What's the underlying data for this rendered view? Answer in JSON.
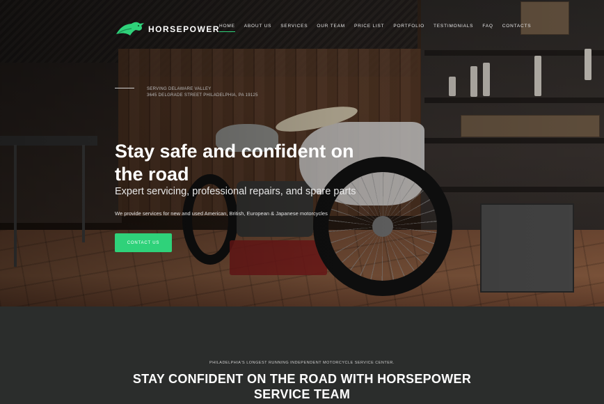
{
  "brand": {
    "name": "HORSEPOWER",
    "accent": "#2fd27a",
    "logo_icon": "horse-head-icon"
  },
  "nav": {
    "items": [
      {
        "label": "HOME",
        "active": true
      },
      {
        "label": "ABOUT US"
      },
      {
        "label": "SERVICES"
      },
      {
        "label": "OUR TEAM"
      },
      {
        "label": "PRICE LIST"
      },
      {
        "label": "PORTFOLIO"
      },
      {
        "label": "TESTIMONIALS"
      },
      {
        "label": "FAQ"
      },
      {
        "label": "CONTACTS"
      }
    ]
  },
  "hero": {
    "serving": "SERVING DELAWARE VALLEY",
    "address": "3645 DELGRADE STREET PHILADELPHIA, PA 19125",
    "headline": "Stay safe and confident on the road",
    "subheadline": "Expert servicing, professional repairs, and spare parts",
    "description": "We provide services for new and used American, British, European & Japanese motorcycles",
    "cta_label": "CONTACT US"
  },
  "section": {
    "eyebrow": "PHILADELPHIA'S LONGEST RUNNING INDEPENDENT MOTORCYCLE SERVICE CENTER.",
    "title": "STAY CONFIDENT ON THE ROAD WITH HORSEPOWER SERVICE TEAM"
  }
}
